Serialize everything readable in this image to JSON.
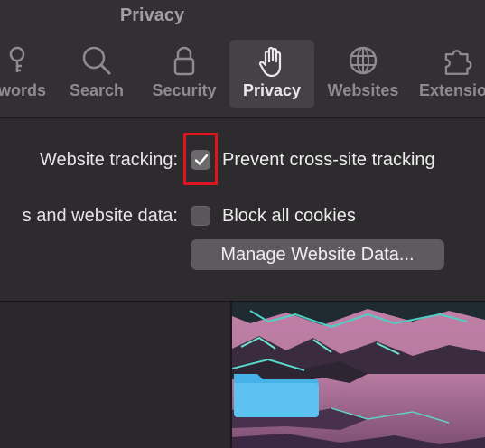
{
  "window": {
    "title": "Privacy"
  },
  "tabs": [
    {
      "label": "words",
      "icon": "key-icon"
    },
    {
      "label": "Search",
      "icon": "search-icon"
    },
    {
      "label": "Security",
      "icon": "lock-icon"
    },
    {
      "label": "Privacy",
      "icon": "hand-icon",
      "selected": true
    },
    {
      "label": "Websites",
      "icon": "globe-icon"
    },
    {
      "label": "Extensio",
      "icon": "puzzle-icon"
    }
  ],
  "privacy": {
    "tracking_label": "Website tracking:",
    "tracking_option": "Prevent cross-site tracking",
    "tracking_checked": true,
    "cookies_label": "s and website data:",
    "cookies_option": "Block all cookies",
    "cookies_checked": false,
    "manage_button": "Manage Website Data..."
  },
  "colors": {
    "highlight_border": "#e0141c",
    "selected_tab_bg": "#454245",
    "window_bg": "#2d2b2d"
  }
}
